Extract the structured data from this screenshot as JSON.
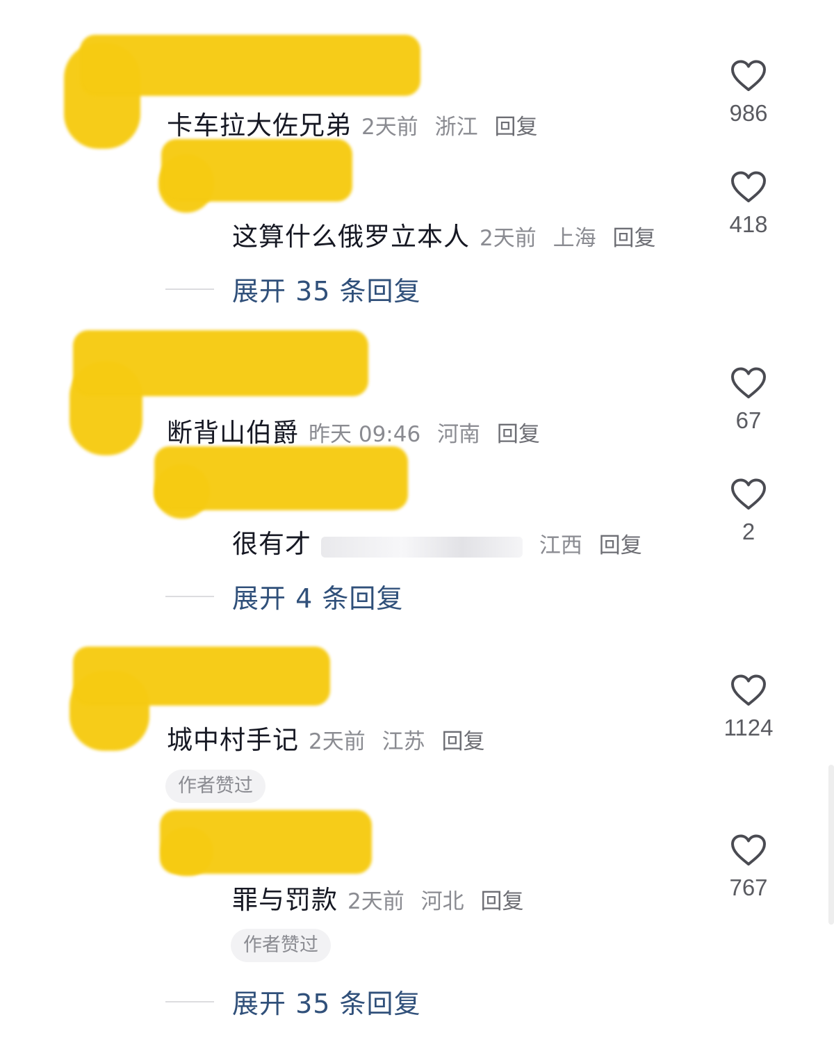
{
  "comments": [
    {
      "name": "卡车拉大佐兄弟",
      "time": "2天前",
      "location": "浙江",
      "reply": "回复",
      "likes": "986",
      "author_liked": false,
      "sub": {
        "name": "这算什么俄罗立本人",
        "time": "2天前",
        "location": "上海",
        "reply": "回复",
        "likes": "418",
        "author_liked": false
      },
      "expand_label": "展开 35 条回复"
    },
    {
      "name": "断背山伯爵",
      "time": "昨天 09:46",
      "location": "河南",
      "reply": "回复",
      "likes": "67",
      "author_liked": false,
      "sub": {
        "name": "很有才",
        "time": "",
        "location": "江西",
        "reply": "回复",
        "likes": "2",
        "author_liked": false
      },
      "expand_label": "展开 4 条回复"
    },
    {
      "name": "城中村手记",
      "time": "2天前",
      "location": "江苏",
      "reply": "回复",
      "likes": "1124",
      "author_liked": true,
      "badge": "作者赞过",
      "sub": {
        "name": "罪与罚款",
        "time": "2天前",
        "location": "河北",
        "reply": "回复",
        "likes": "767",
        "author_liked": true,
        "badge": "作者赞过"
      },
      "expand_label": "展开 35 条回复"
    }
  ],
  "colors": {
    "redaction": "#f6cb12",
    "expand_link": "#30507a",
    "meta": "#8a8b91"
  },
  "icons": {
    "like": "heart-outline-icon"
  }
}
